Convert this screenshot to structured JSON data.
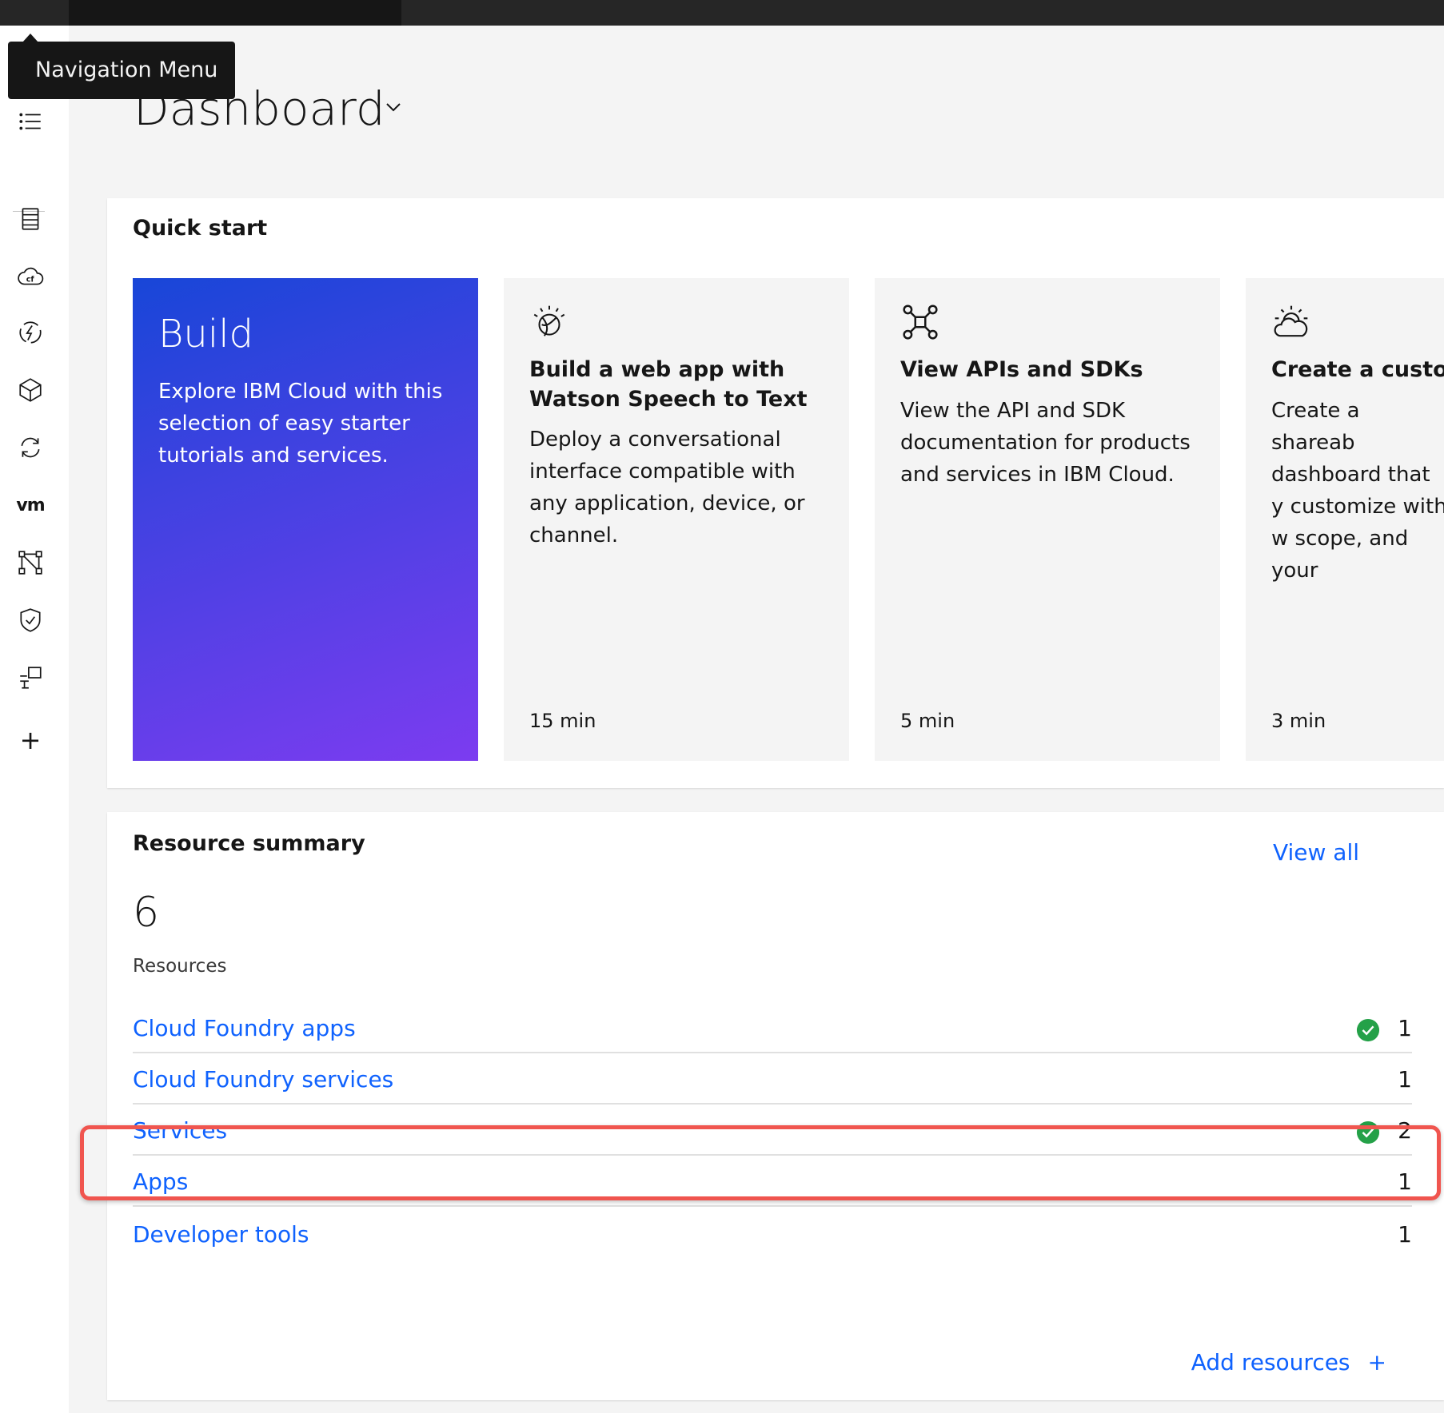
{
  "tooltip": {
    "text": "Navigation Menu"
  },
  "page": {
    "title": "Dashboard"
  },
  "sidebar": {
    "icons": [
      "menu-list-icon",
      "resource-list-icon",
      "cloud-foundry-icon",
      "functions-icon",
      "kubernetes-box-icon",
      "sync-icon",
      "vmware-icon",
      "network-icon",
      "security-shield-icon",
      "devices-icon",
      "add-icon"
    ],
    "vm_label": "vm",
    "plus_label": "+"
  },
  "quick_start": {
    "heading": "Quick start",
    "tiles": [
      {
        "title": "Build",
        "description": "Explore IBM Cloud with this selection of easy starter tutorials and services.",
        "icon": ""
      },
      {
        "title": "Build a web app with\nWatson Speech to Text",
        "description": "Deploy a conversational interface compatible with any application, device, or channel.",
        "time": "15 min",
        "icon": "watson-icon"
      },
      {
        "title": "View APIs and SDKs",
        "description": "View the API and SDK documentation for products and services in IBM Cloud.",
        "time": "5 min",
        "icon": "api-network-icon"
      },
      {
        "title": "Create a custom",
        "description": "Create a shareab dashboard that y customize with w scope, and your",
        "time": "3 min",
        "icon": "partly-cloudy-icon"
      }
    ]
  },
  "resource_summary": {
    "heading": "Resource summary",
    "view_all": "View all",
    "count": "6",
    "count_label": "Resources",
    "rows": [
      {
        "label": "Cloud Foundry apps",
        "value": "1",
        "status": "ok"
      },
      {
        "label": "Cloud Foundry services",
        "value": "1",
        "status": ""
      },
      {
        "label": "Services",
        "value": "2",
        "status": "ok"
      },
      {
        "label": "Apps",
        "value": "1",
        "status": ""
      },
      {
        "label": "Developer tools",
        "value": "1",
        "status": ""
      }
    ],
    "add_resources": "Add resources",
    "add_icon": "+"
  },
  "colors": {
    "link": "#0f62fe",
    "highlight": "#f0554f",
    "ok": "#24a148",
    "build_gradient_start": "#1846d8",
    "build_gradient_end": "#7c3cf0"
  }
}
